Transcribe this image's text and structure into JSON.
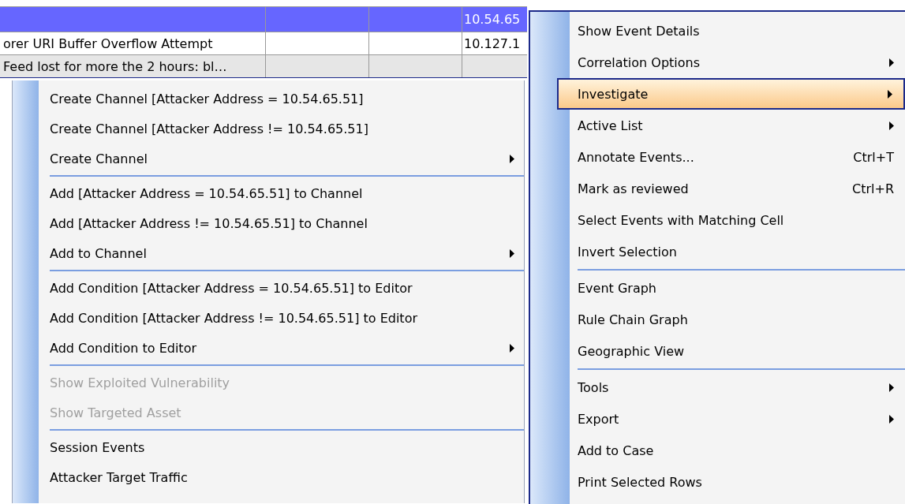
{
  "table": {
    "rows": [
      {
        "selected": true,
        "cells": [
          "",
          "",
          "",
          "10.54.65"
        ]
      },
      {
        "selected": false,
        "cells": [
          "orer URI Buffer Overflow Attempt",
          "",
          "",
          "10.127.1"
        ]
      },
      {
        "selected": false,
        "cells": [
          "Feed lost for more the 2 hours: bl…",
          "",
          "",
          ""
        ]
      }
    ]
  },
  "context_menu": {
    "items": [
      {
        "kind": "item",
        "label": "Create Channel [Attacker Address = 10.54.65.51]",
        "submenu": false,
        "disabled": false
      },
      {
        "kind": "item",
        "label": "Create Channel [Attacker Address != 10.54.65.51]",
        "submenu": false,
        "disabled": false
      },
      {
        "kind": "item",
        "label": "Create Channel",
        "submenu": true,
        "disabled": false
      },
      {
        "kind": "separator"
      },
      {
        "kind": "item",
        "label": "Add [Attacker Address = 10.54.65.51] to Channel",
        "submenu": false,
        "disabled": false
      },
      {
        "kind": "item",
        "label": "Add [Attacker Address != 10.54.65.51] to Channel",
        "submenu": false,
        "disabled": false
      },
      {
        "kind": "item",
        "label": "Add to Channel",
        "submenu": true,
        "disabled": false
      },
      {
        "kind": "separator"
      },
      {
        "kind": "item",
        "label": "Add Condition [Attacker Address = 10.54.65.51] to Editor",
        "submenu": false,
        "disabled": false
      },
      {
        "kind": "item",
        "label": "Add Condition [Attacker Address != 10.54.65.51] to Editor",
        "submenu": false,
        "disabled": false
      },
      {
        "kind": "item",
        "label": "Add Condition to Editor",
        "submenu": true,
        "disabled": false
      },
      {
        "kind": "separator"
      },
      {
        "kind": "item",
        "label": "Show Exploited Vulnerability",
        "submenu": false,
        "disabled": true
      },
      {
        "kind": "item",
        "label": "Show Targeted Asset",
        "submenu": false,
        "disabled": true
      },
      {
        "kind": "separator"
      },
      {
        "kind": "item",
        "label": "Session Events",
        "submenu": false,
        "disabled": false
      },
      {
        "kind": "item",
        "label": "Attacker Target Traffic",
        "submenu": false,
        "disabled": false
      }
    ]
  },
  "main_menu": {
    "items": [
      {
        "kind": "item",
        "label": "Show Event Details",
        "submenu": false,
        "selected": false
      },
      {
        "kind": "item",
        "label": "Correlation Options",
        "submenu": true,
        "selected": false
      },
      {
        "kind": "item",
        "label": "Investigate",
        "submenu": true,
        "selected": true
      },
      {
        "kind": "item",
        "label": "Active List",
        "submenu": true,
        "selected": false
      },
      {
        "kind": "item",
        "label": "Annotate Events...",
        "shortcut": "Ctrl+T",
        "submenu": false,
        "selected": false
      },
      {
        "kind": "item",
        "label": "Mark as reviewed",
        "shortcut": "Ctrl+R",
        "submenu": false,
        "selected": false
      },
      {
        "kind": "item",
        "label": "Select Events with Matching Cell",
        "submenu": false,
        "selected": false
      },
      {
        "kind": "item",
        "label": "Invert Selection",
        "submenu": false,
        "selected": false
      },
      {
        "kind": "separator"
      },
      {
        "kind": "item",
        "label": "Event Graph",
        "submenu": false,
        "selected": false
      },
      {
        "kind": "item",
        "label": "Rule Chain Graph",
        "submenu": false,
        "selected": false
      },
      {
        "kind": "item",
        "label": "Geographic View",
        "submenu": false,
        "selected": false
      },
      {
        "kind": "separator"
      },
      {
        "kind": "item",
        "label": "Tools",
        "submenu": true,
        "selected": false
      },
      {
        "kind": "item",
        "label": "Export",
        "submenu": true,
        "selected": false
      },
      {
        "kind": "item",
        "label": "Add to Case",
        "submenu": false,
        "selected": false
      },
      {
        "kind": "item",
        "label": "Print Selected Rows",
        "submenu": false,
        "selected": false
      }
    ]
  }
}
